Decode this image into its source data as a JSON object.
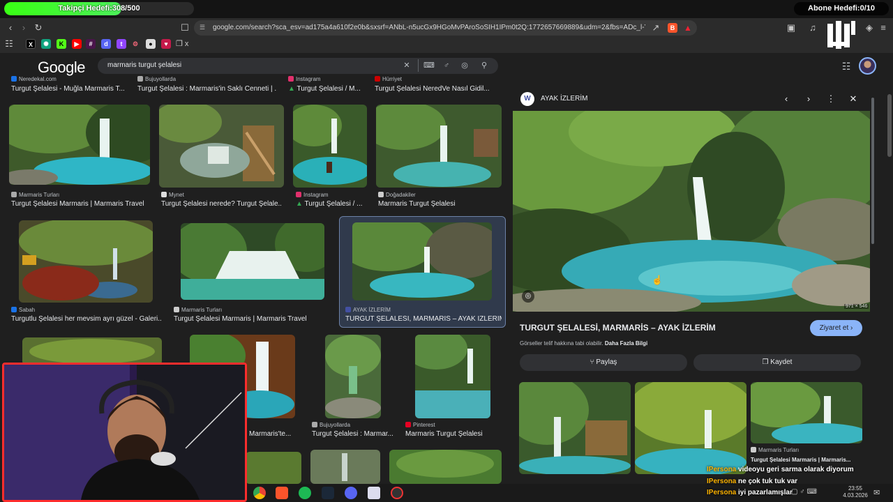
{
  "overlay": {
    "follower_goal": "Takipçi Hedefi:308/500",
    "follower_progress": 0.616,
    "subscriber_goal": "Abone Hedefi:0/10"
  },
  "browser": {
    "url": "google.com/search?sca_esv=ad175a4a610f2e0b&sxsrf=ANbL-n5ucGx9HGoMvPAroSoSIH1IPm0t2Q:1772657669889&udm=2&fbs=ADc_l-Yk7dC9rTo...",
    "bookmarks": [
      "x",
      "chatgpt",
      "kick",
      "youtube",
      "slack",
      "discord",
      "twitch",
      "settings",
      "github",
      "raspberry",
      "folder"
    ],
    "bookmark_tail": "x"
  },
  "search": {
    "logo": "Google",
    "query": "marmaris turgut şelalesi"
  },
  "results": {
    "top_row": [
      {
        "source": "Neredekal.com",
        "title": "Turgut Şelalesi - Muğla Marmaris T..."
      },
      {
        "source": "Bujuyollarda",
        "title": "Turgut Şelalesi : Marmaris'in Saklı Cenneti | ..."
      },
      {
        "source": "Instagram",
        "title": "Turgut Şelalesi / M..."
      },
      {
        "source": "Hürriyet",
        "title": "Turgut Şelalesi NeredVe Nasıl Gidil..."
      }
    ],
    "row1": [
      {
        "source": "Marmaris Turları",
        "title": "Turgut Şelalesi Marmaris | Marmaris Travel"
      },
      {
        "source": "Mynet",
        "title": "Turgut Şelalesi nerede? Turgut Şelale..."
      },
      {
        "source": "Instagram",
        "title": "Turgut Şelalesi / ..."
      },
      {
        "source": "Doğadakiler",
        "title": "Marmaris Turgut Şelalesi"
      }
    ],
    "row2": [
      {
        "source": "Sabah",
        "title": "Turgutlu Şelalesi her mevsim ayrı güzel - Galeri..."
      },
      {
        "source": "Marmaris Turları",
        "title": "Turgut Şelalesi Marmaris | Marmaris Travel"
      },
      {
        "source": "AYAK İZLERİM",
        "title": "TURGUT ŞELALESİ, MARMARİS – AYAK İZLERİM"
      }
    ],
    "row3": [
      {
        "source": "eri",
        "title": "rü | Marmaris'te..."
      },
      {
        "source": "Bujuyollarda",
        "title": "Turgut Şelalesi : Marmar..."
      },
      {
        "source": "Pinterest",
        "title": "Marmaris Turgut Şelalesi"
      }
    ]
  },
  "panel": {
    "source": "AYAK İZLERİM",
    "dimensions": "971 × 546",
    "title": "TURGUT ŞELALESİ, MARMARİS – AYAK İZLERİM",
    "visit_label": "Ziyaret et",
    "copyright": "Görseller telif hakkına tabi olabilir.",
    "more_info": "Daha Fazla Bilgi",
    "share_label": "Paylaş",
    "save_label": "Kaydet",
    "related_source": "Marmaris Turları",
    "related_title": "Turgut Şelalesi Marmaris | Marmaris..."
  },
  "chat": [
    {
      "name": "IPersona",
      "message": "videoyu geri sarma olarak diyorum"
    },
    {
      "name": "IPersona",
      "message": "ne çok tuk tuk var"
    },
    {
      "name": "IPersona",
      "message": "iyi pazarlamışlar"
    }
  ],
  "taskbar": {
    "time": "23:55",
    "date": "4.03.2026"
  },
  "colors": {
    "accent_blue": "#8ab4f8",
    "progress_green": "#39ff14",
    "webcam_border": "#ff2d2d"
  }
}
